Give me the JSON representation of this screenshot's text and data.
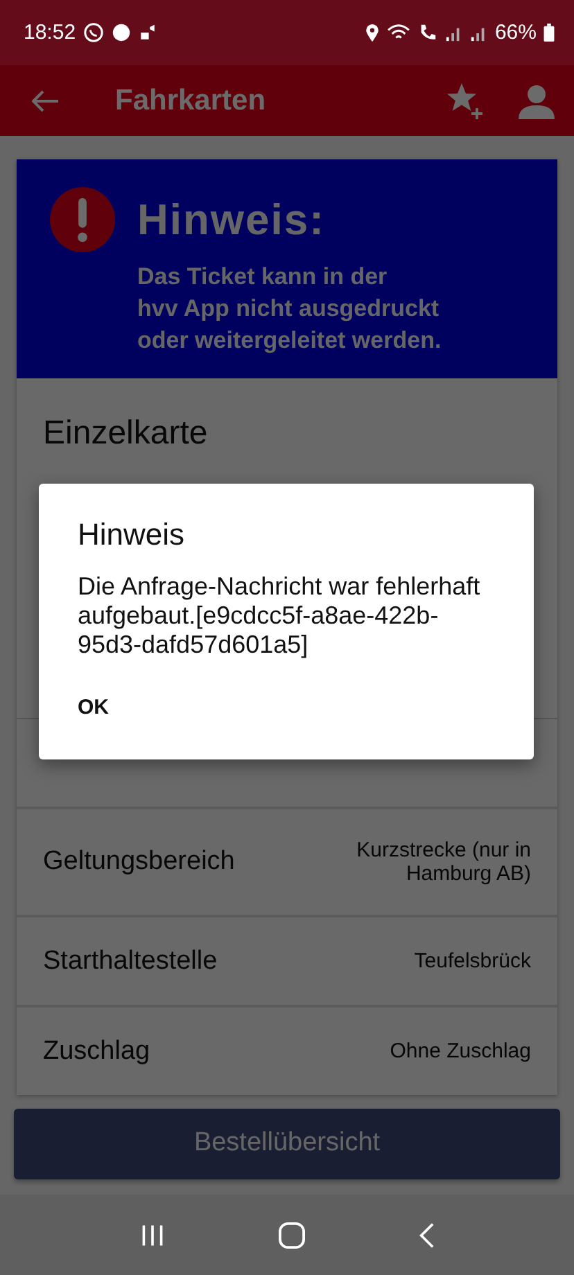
{
  "status_bar": {
    "time": "18:52",
    "battery": "66%"
  },
  "app_bar": {
    "title": "Fahrkarten"
  },
  "banner": {
    "title": "Hinweis:",
    "lines": [
      "Das Ticket kann in der",
      "hvv App nicht ausgedruckt",
      "oder weitergeleitet werden."
    ]
  },
  "ticket": {
    "title": "Einzelkarte"
  },
  "details": [
    {
      "label": "Geltungsbereich",
      "value": "Kurzstrecke (nur in Hamburg AB)"
    },
    {
      "label": "Starthaltestelle",
      "value": "Teufelsbrück"
    },
    {
      "label": "Zuschlag",
      "value": "Ohne Zuschlag"
    }
  ],
  "order_button": {
    "label": "Bestellübersicht"
  },
  "dialog": {
    "title": "Hinweis",
    "message": "Die Anfrage-Nachricht war fehlerhaft aufgebaut.[e9cdcc5f-a8ae-422b-95d3-dafd57d601a5]",
    "buttons": [
      "OK"
    ]
  }
}
